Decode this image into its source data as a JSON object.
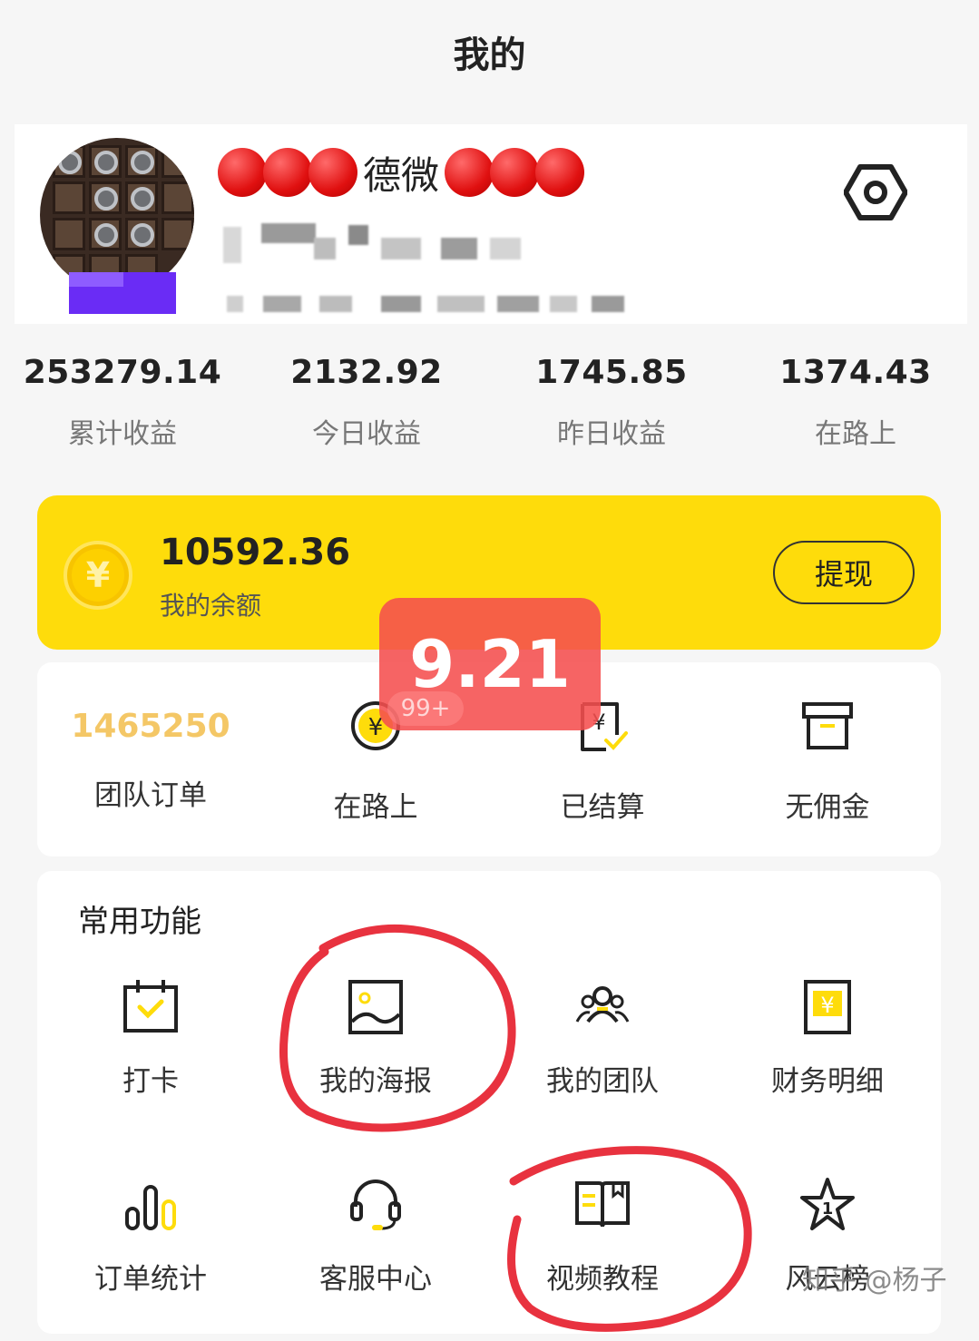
{
  "header": {
    "title": "我的"
  },
  "profile": {
    "name_text": "德微",
    "settings_icon": "hexagon-settings-icon"
  },
  "stats": [
    {
      "value": "253279.14",
      "label": "累计收益"
    },
    {
      "value": "2132.92",
      "label": "今日收益"
    },
    {
      "value": "1745.85",
      "label": "昨日收益"
    },
    {
      "value": "1374.43",
      "label": "在路上"
    }
  ],
  "balance": {
    "amount": "10592.36",
    "label": "我的余额",
    "coin_symbol": "¥",
    "withdraw_label": "提现",
    "color": "#fedc0b"
  },
  "orders": {
    "team_count": "1465250",
    "team_label": "团队订单",
    "items": [
      {
        "label": "在路上",
        "icon": "yen-coin-icon"
      },
      {
        "label": "已结算",
        "icon": "yen-document-check-icon"
      },
      {
        "label": "无佣金",
        "icon": "archive-box-icon"
      }
    ],
    "badge_small": "99+",
    "overlay_badge": "9.21"
  },
  "functions": {
    "title": "常用功能",
    "items": [
      {
        "label": "打卡",
        "icon": "calendar-check-icon"
      },
      {
        "label": "我的海报",
        "icon": "image-icon"
      },
      {
        "label": "我的团队",
        "icon": "team-icon"
      },
      {
        "label": "财务明细",
        "icon": "yen-document-icon"
      },
      {
        "label": "订单统计",
        "icon": "bar-chart-icon"
      },
      {
        "label": "客服中心",
        "icon": "headset-icon"
      },
      {
        "label": "视频教程",
        "icon": "book-icon"
      },
      {
        "label": "风云榜",
        "icon": "star-icon"
      }
    ]
  },
  "watermark": "知乎 @杨子",
  "accent_yellow": "#fedc0b",
  "annotation_red": "#e8323f"
}
